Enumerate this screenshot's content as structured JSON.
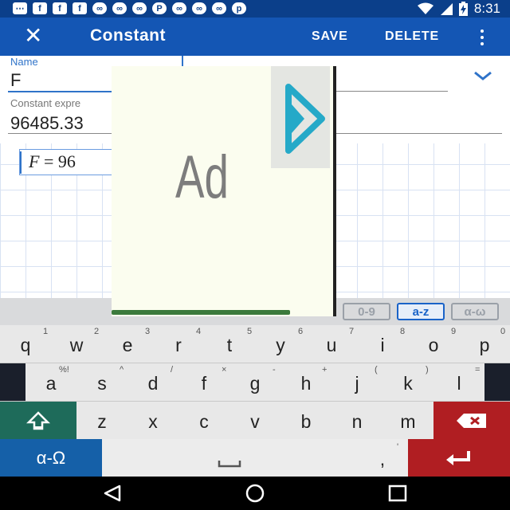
{
  "status_bar": {
    "time": "8:31",
    "left_icons": [
      "messages-icon",
      "facebook-icon",
      "facebook-icon",
      "facebook-icon",
      "app-icon",
      "app-icon",
      "app-icon",
      "pandora-icon",
      "app-icon",
      "app-icon",
      "app-icon",
      "pinterest-icon"
    ],
    "right_icons": [
      "wifi-icon",
      "signal-icon",
      "battery-charging-icon"
    ]
  },
  "toolbar": {
    "close_icon": "close-icon",
    "title": "Constant",
    "save_label": "SAVE",
    "delete_label": "DELETE",
    "more_icon": "more-vert-icon"
  },
  "form": {
    "name_label": "Name",
    "name_value": "F",
    "expression_label": "Constant expre",
    "expression_value": "96485.33",
    "unit_dropdown_icon": "chevron-down-icon"
  },
  "formula": {
    "symbol": "F",
    "equals": "=",
    "value_visible": "96"
  },
  "keyboard_modes": [
    {
      "label": "0-9",
      "active": false
    },
    {
      "label": "a-z",
      "active": true
    },
    {
      "label": "α-ω",
      "active": false
    }
  ],
  "keyboard": {
    "row1": [
      "q",
      "w",
      "e",
      "r",
      "t",
      "y",
      "u",
      "i",
      "o",
      "p"
    ],
    "row1_hints": [
      "1",
      "2",
      "3",
      "4",
      "5",
      "6",
      "7",
      "8",
      "9",
      "0"
    ],
    "row2": [
      "a",
      "s",
      "d",
      "f",
      "g",
      "h",
      "j",
      "k",
      "l"
    ],
    "row2_hints": [
      "%!",
      "^",
      "/",
      "×",
      "-",
      "+",
      "(",
      ")",
      "="
    ],
    "row3": [
      "z",
      "x",
      "c",
      "v",
      "b",
      "n",
      "m"
    ],
    "shift_icon": "shift-icon",
    "backspace_icon": "backspace-icon",
    "greek_label": "α-Ω",
    "space_icon": "space-bar-icon",
    "comma_label": ",",
    "comma_hint": "'",
    "enter_icon": "enter-icon"
  },
  "ad": {
    "label": "Ad",
    "play_icon": "play-icon"
  },
  "nav_bar": {
    "back_icon": "back-icon",
    "home_icon": "home-icon",
    "recents_icon": "recents-icon"
  },
  "colors": {
    "status_bar": "#0b3f8a",
    "toolbar": "#1456b4",
    "accent": "#2f73c9",
    "shift_key": "#1e6b5a",
    "backspace_key": "#b01e22",
    "greek_key": "#1560a8",
    "enter_key": "#b01e22",
    "ad_play": "#25a9c8"
  }
}
